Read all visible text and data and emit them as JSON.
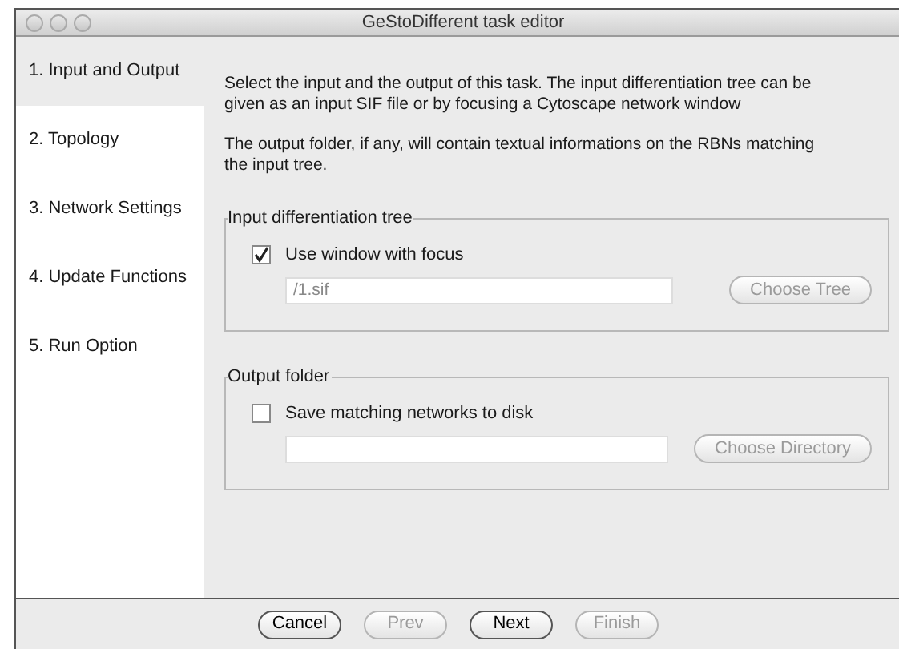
{
  "window": {
    "title": "GeStoDifferent task editor"
  },
  "steps": [
    {
      "label": "1. Input and Output",
      "selected": true
    },
    {
      "label": "2. Topology",
      "selected": false
    },
    {
      "label": "3. Network Settings",
      "selected": false
    },
    {
      "label": "4. Update Functions",
      "selected": false
    },
    {
      "label": "5. Run Option",
      "selected": false
    }
  ],
  "description": [
    "Select the input and the output of this task. The input differentiation tree can be given as an input SIF file or by focusing a Cytoscape network window",
    "The output folder, if any, will contain textual informations on the RBNs matching the input tree."
  ],
  "groups": [
    {
      "title": "Input differentiation tree",
      "checkbox": {
        "label": "Use window with focus",
        "checked": true
      },
      "field": {
        "value": "/1.sif",
        "disabled": true
      },
      "button": {
        "label": "Choose Tree",
        "disabled": true
      }
    },
    {
      "title": "Output folder",
      "checkbox": {
        "label": "Save matching networks to disk",
        "checked": false
      },
      "button": {
        "label": "Choose Directory",
        "disabled": true
      }
    }
  ],
  "buttons": [
    {
      "label": "Cancel",
      "disabled": false
    },
    {
      "label": "Prev",
      "disabled": true
    },
    {
      "label": "Next",
      "disabled": false
    },
    {
      "label": "Finish",
      "disabled": true
    }
  ]
}
